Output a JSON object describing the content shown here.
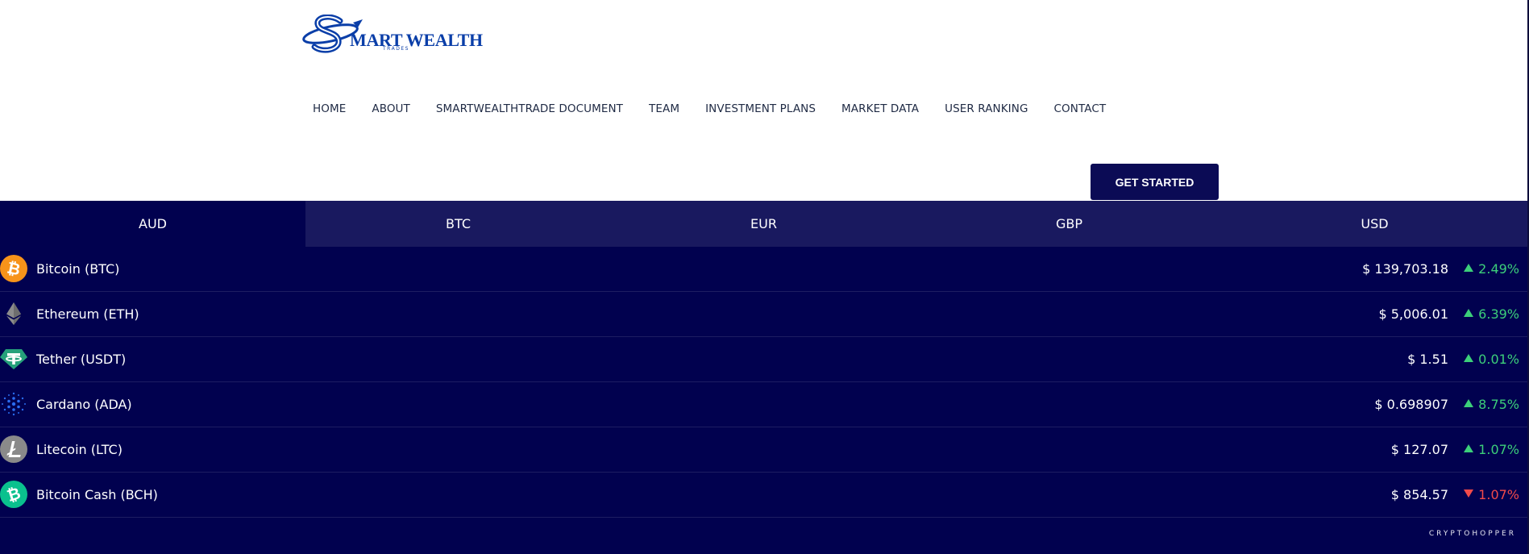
{
  "logo": {
    "text": "MART WEALTH",
    "sub": "TRADES"
  },
  "nav": {
    "items": [
      {
        "id": "home",
        "label": "HOME"
      },
      {
        "id": "about",
        "label": "ABOUT"
      },
      {
        "id": "document",
        "label": "SMARTWEALTHTRADE DOCUMENT"
      },
      {
        "id": "team",
        "label": "TEAM"
      },
      {
        "id": "plans",
        "label": "INVESTMENT PLANS"
      },
      {
        "id": "market",
        "label": "MARKET DATA"
      },
      {
        "id": "ranking",
        "label": "USER RANKING"
      },
      {
        "id": "contact",
        "label": "CONTACT"
      }
    ]
  },
  "cta": {
    "label": "GET STARTED"
  },
  "widget": {
    "tabs": [
      {
        "label": "AUD",
        "active": true
      },
      {
        "label": "BTC",
        "active": false
      },
      {
        "label": "EUR",
        "active": false
      },
      {
        "label": "GBP",
        "active": false
      },
      {
        "label": "USD",
        "active": false
      }
    ],
    "coins": [
      {
        "name": "Bitcoin (BTC)",
        "price": "$ 139,703.18",
        "change": "2.49%",
        "direction": "up",
        "icon": "bitcoin-icon",
        "color": "#f7931a"
      },
      {
        "name": "Ethereum (ETH)",
        "price": "$ 5,006.01",
        "change": "6.39%",
        "direction": "up",
        "icon": "ethereum-icon",
        "color": "#8c8c8c"
      },
      {
        "name": "Tether (USDT)",
        "price": "$ 1.51",
        "change": "0.01%",
        "direction": "up",
        "icon": "tether-icon",
        "color": "#26a17b"
      },
      {
        "name": "Cardano (ADA)",
        "price": "$ 0.698907",
        "change": "8.75%",
        "direction": "up",
        "icon": "cardano-icon",
        "color": "#1e5ed6"
      },
      {
        "name": "Litecoin (LTC)",
        "price": "$ 127.07",
        "change": "1.07%",
        "direction": "up",
        "icon": "litecoin-icon",
        "color": "#8a8a8a"
      },
      {
        "name": "Bitcoin Cash (BCH)",
        "price": "$ 854.57",
        "change": "1.07%",
        "direction": "down",
        "icon": "bitcoin-cash-icon",
        "color": "#0ac18e"
      }
    ],
    "powered_by": "CRYPTOHOPPER"
  },
  "colors": {
    "brand": "#0a3ea8",
    "widget_bg": "#01014f",
    "tab_bg": "#19195f",
    "up": "#3ccf7a",
    "down": "#f24a4a"
  }
}
